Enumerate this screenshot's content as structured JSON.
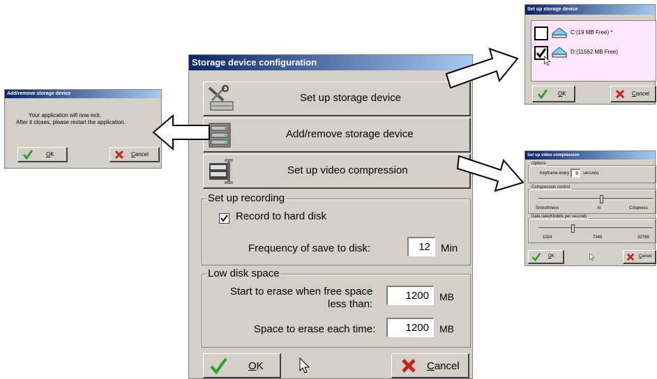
{
  "main": {
    "title": "Storage device configuration",
    "buttons": {
      "setup_storage": "Set up storage device",
      "add_remove": "Add/remove storage device",
      "video_compression": "Set up video compression"
    },
    "recording": {
      "legend": "Set up recording",
      "record_label": "Record to hard disk",
      "record_checked": true,
      "frequency_label": "Frequency of save to disk:",
      "frequency_value": "12",
      "frequency_unit": "Min"
    },
    "low_disk": {
      "legend": "Low disk space",
      "start_label_1": "Start to erase when free space",
      "start_label_2": "less than:",
      "start_value": "1200",
      "start_unit": "MB",
      "space_label": "Space to erase each time:",
      "space_value": "1200",
      "space_unit": "MB"
    },
    "ok_label": "OK",
    "cancel_label": "Cancel"
  },
  "add_remove_dialog": {
    "title": "Add/remove storage device",
    "line1": "Your application will now exit.",
    "line2": "After it closes, please restart the application.",
    "ok_label": "OK",
    "cancel_label": "Cancel"
  },
  "storage_dialog": {
    "title": "Set up storage device",
    "drives": [
      {
        "label": "C:(19 MB Free) *",
        "checked": false
      },
      {
        "label": "D:(11562 MB Free)",
        "checked": true
      }
    ],
    "ok_label": "OK",
    "cancel_label": "Cancel"
  },
  "video_dialog": {
    "title": "Set up video compression",
    "options_legend": "Options",
    "keyframe_label": "Keyframe every",
    "keyframe_value": "8",
    "keyframe_unit": "seconds",
    "compression_legend": "Compression control",
    "compression_level": 0.55,
    "smoothness_label": "Smoothness",
    "compression_mid": "A\\",
    "crispness_label": "Crispness",
    "datarate_legend": "Data rate(Kilobits per second)",
    "datarate_level": 0.3,
    "rate_min": "1024",
    "rate_mid": "7348",
    "rate_max": "32768",
    "ok_label": "OK",
    "cancel_label": "Cancel"
  },
  "colors": {
    "title_start": "#0a246a",
    "title_end": "#a6caf0",
    "check_green": "#2aa02a",
    "cancel_red": "#c81e1e",
    "storage_list_bg": "#ffe6ff"
  }
}
